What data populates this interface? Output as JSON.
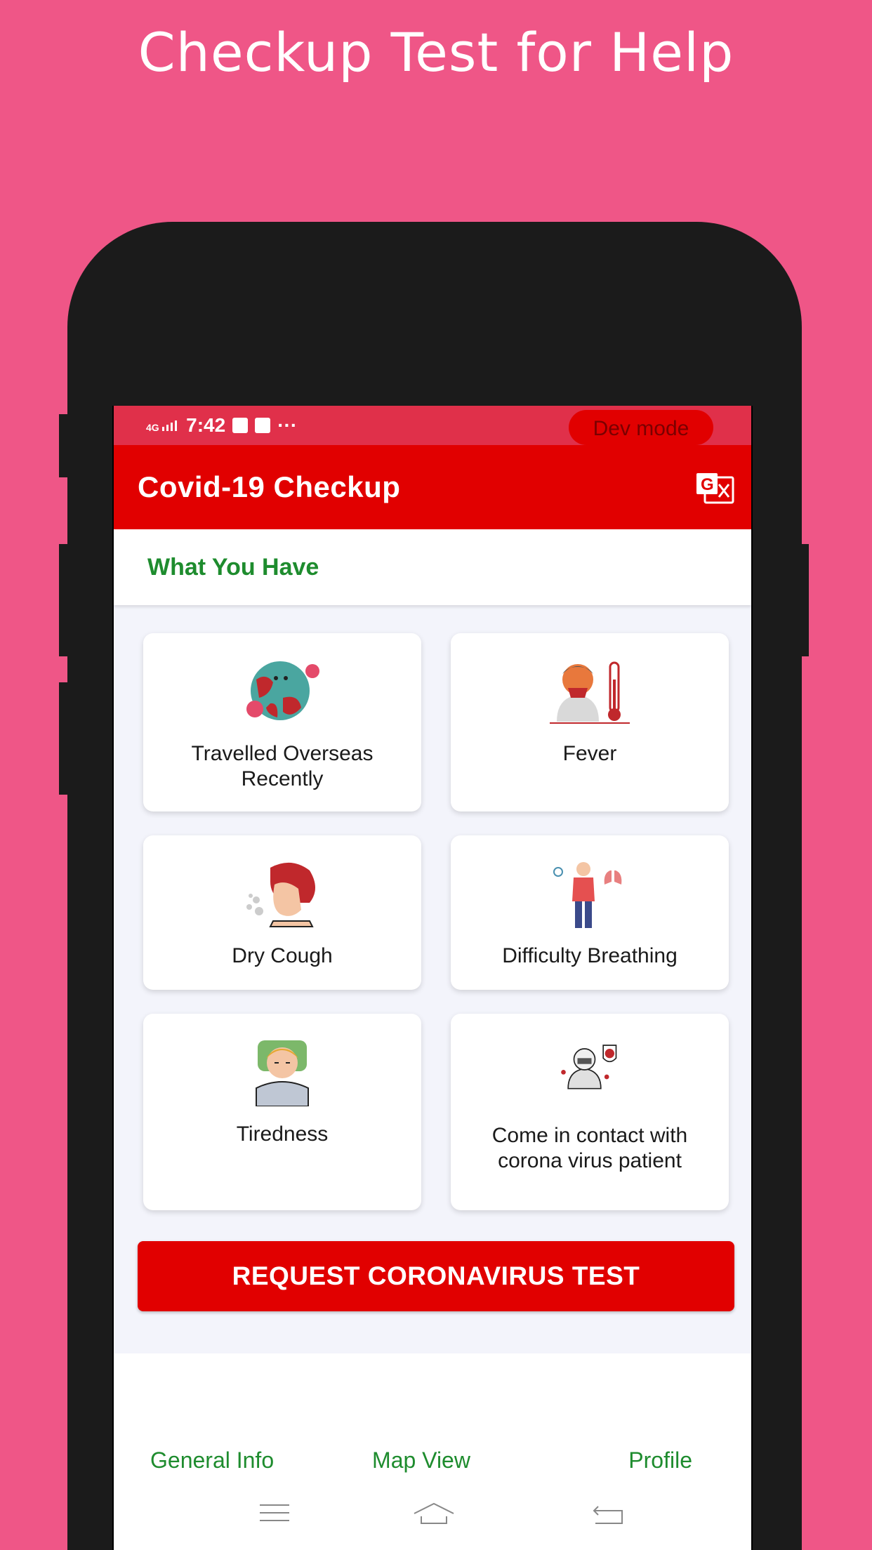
{
  "promo": {
    "title": "Checkup Test for Help"
  },
  "status_bar": {
    "network": "4G",
    "time": "7:42",
    "more": "···",
    "dev_mode": "Dev mode"
  },
  "app_bar": {
    "title": "Covid-19 Checkup",
    "translate_icon": "translate-icon"
  },
  "section": {
    "title": "What You Have"
  },
  "symptoms": [
    {
      "label": "Travelled Overseas Recently",
      "icon": "globe-virus-icon"
    },
    {
      "label": "Fever",
      "icon": "fever-thermometer-icon"
    },
    {
      "label": "Dry Cough",
      "icon": "cough-icon"
    },
    {
      "label": "Difficulty Breathing",
      "icon": "breathing-lungs-icon"
    },
    {
      "label": "Tiredness",
      "icon": "tired-person-icon"
    },
    {
      "label": "Come in contact with corona virus patient",
      "icon": "virus-contact-icon"
    }
  ],
  "actions": {
    "request_test": "REQUEST CORONAVIRUS TEST"
  },
  "bottom_nav": [
    {
      "label": "General Info"
    },
    {
      "label": "Map View"
    },
    {
      "label": "Profile"
    }
  ],
  "colors": {
    "background": "#ef5687",
    "primary_red": "#e10000",
    "status_red": "#e0304a",
    "green": "#1e8c2e"
  }
}
